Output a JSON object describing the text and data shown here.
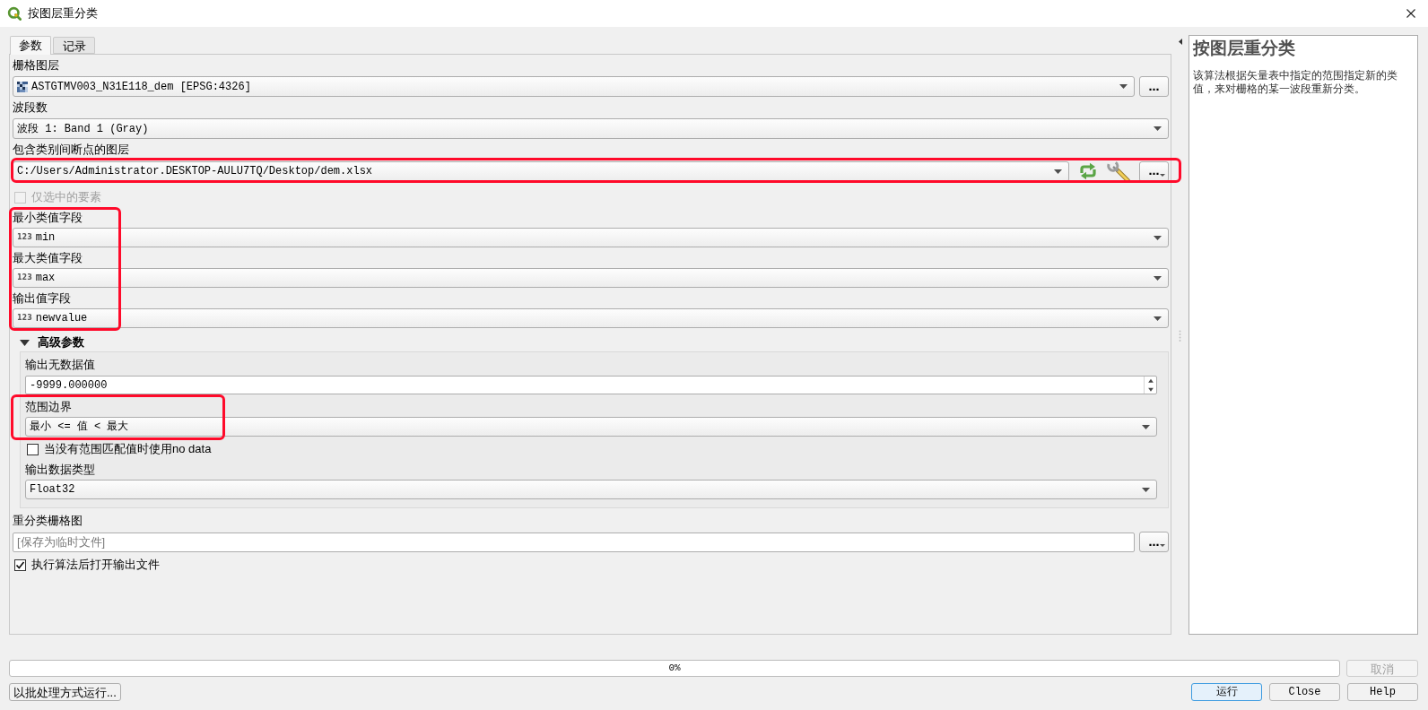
{
  "window": {
    "title": "按图层重分类"
  },
  "tabs": [
    {
      "label": "参数",
      "selected": true
    },
    {
      "label": "记录",
      "selected": false
    }
  ],
  "params": [
    {
      "kind": "layer",
      "label": "栅格图层",
      "value": "ASTGTMV003_N31E118_dem [EPSG:4326]",
      "highlighted": false,
      "browse": {
        "label": "…",
        "menu": false
      }
    },
    {
      "kind": "combo",
      "label": "波段数",
      "value": "波段 1: Band 1 (Gray)",
      "highlighted": false
    },
    {
      "kind": "vector_layer",
      "label": "包含类别间断点的图层",
      "value": "C:/Users/Administrator.DESKTOP-AULU7TQ/Desktop/dem.xlsx",
      "highlighted": true,
      "browse": {
        "label": "…",
        "menu": true
      }
    },
    {
      "kind": "checkbox",
      "label": "仅选中的要素",
      "checked": false,
      "disabled": true,
      "highlighted": false
    },
    {
      "kind": "field_group",
      "highlighted": true,
      "fields": [
        {
          "label": "最小类值字段",
          "type_label": "123",
          "value": "min"
        },
        {
          "label": "最大类值字段",
          "type_label": "123",
          "value": "max"
        },
        {
          "label": "输出值字段",
          "type_label": "123",
          "value": "newvalue"
        }
      ]
    }
  ],
  "advanced": {
    "label": "高级参数",
    "expanded": true,
    "params": [
      {
        "kind": "spin",
        "label": "输出无数据值",
        "value": "-9999.000000",
        "highlighted": false
      },
      {
        "kind": "combo",
        "label": "范围边界",
        "value": "最小 <= 值 < 最大",
        "highlighted": true
      },
      {
        "kind": "checkbox",
        "label": "当没有范围匹配值时使用no data",
        "checked": false,
        "disabled": false,
        "highlighted": false
      },
      {
        "kind": "combo",
        "label": "输出数据类型",
        "value": "Float32",
        "highlighted": false
      }
    ]
  },
  "outputs": [
    {
      "kind": "file",
      "label": "重分类栅格图",
      "placeholder": "[保存为临时文件]",
      "highlighted": false,
      "browse": {
        "label": "…",
        "menu": true
      }
    },
    {
      "kind": "checkbox",
      "label": "执行算法后打开输出文件",
      "checked": true,
      "disabled": false,
      "highlighted": false
    }
  ],
  "help": {
    "title": "按图层重分类",
    "text": "该算法根据矢量表中指定的范围指定新的类值，来对栅格的某一波段重新分类。"
  },
  "progress": {
    "level": 0,
    "label": "0%"
  },
  "cancel_button": {
    "label": "取消",
    "disabled": true
  },
  "batch_button": {
    "label": "以批处理方式运行..."
  },
  "buttons": [
    {
      "label": "运行",
      "default": true
    },
    {
      "label": "Close",
      "default": false
    },
    {
      "label": "Help",
      "default": false
    }
  ]
}
